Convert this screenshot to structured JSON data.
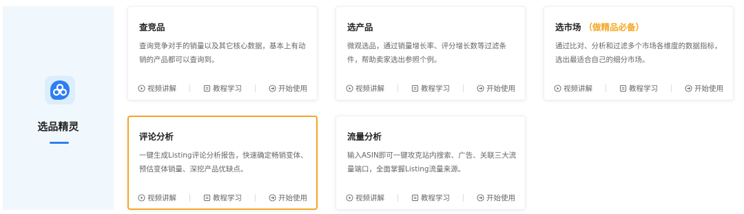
{
  "sidebar": {
    "title": "选品精灵",
    "icon": "app-logo-icon",
    "accent": "#2f7ef1"
  },
  "actions": {
    "video": "视频讲解",
    "tutorial": "教程学习",
    "start": "开始使用"
  },
  "cards": [
    {
      "title": "查竞品",
      "badge": "",
      "desc": "查询竞争对手的销量以及其它核心数据，基本上有动销的产品都可以查询到。"
    },
    {
      "title": "选产品",
      "badge": "",
      "desc": "微观选品，通过销量增长率、评分增长数等过滤条件，帮助卖家选出参照个例。"
    },
    {
      "title": "选市场",
      "badge": "（做精品必备）",
      "desc": "通过比对、分析和过滤多个市场各维度的数据指标，选出最适合自己的细分市场。"
    },
    {
      "title": "评论分析",
      "badge": "",
      "desc": "一键生成Listing评论分析报告，快速确定畅销变体、预估变体销量、深挖产品优缺点。"
    },
    {
      "title": "流量分析",
      "badge": "",
      "desc": "输入ASIN即可一键攻克站内搜索、广告、关联三大流量端口，全面掌握Listing流量来源。"
    }
  ],
  "colors": {
    "highlight_border": "#f5a623",
    "badge": "#f5a623",
    "sidebar_bg": "#f1f8fd"
  }
}
